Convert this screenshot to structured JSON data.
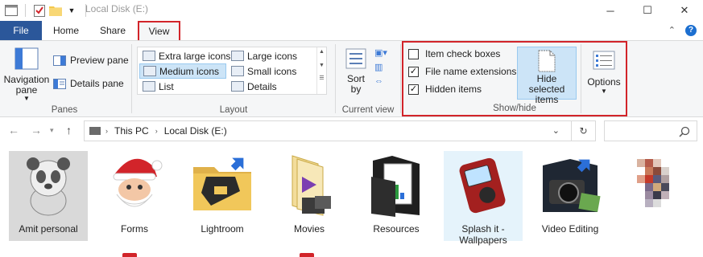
{
  "window": {
    "title": "Local Disk (E:)",
    "controls": {
      "minimize": "─",
      "maximize": "☐",
      "close": "✕"
    }
  },
  "quick_access": {
    "icons": [
      "explorer-icon",
      "properties-check-icon",
      "new-folder-icon",
      "customize-dropdown-icon"
    ]
  },
  "tabs": [
    {
      "label": "File"
    },
    {
      "label": "Home"
    },
    {
      "label": "Share"
    },
    {
      "label": "View"
    }
  ],
  "ribbon": {
    "panes": {
      "navigation_pane": "Navigation pane",
      "preview_pane": "Preview pane",
      "details_pane": "Details pane",
      "label": "Panes"
    },
    "layout": {
      "items": [
        "Extra large icons",
        "Large icons",
        "Medium icons",
        "Small icons",
        "List",
        "Details"
      ],
      "selected": "Medium icons",
      "label": "Layout"
    },
    "current_view": {
      "sort_by": "Sort by",
      "label": "Current view"
    },
    "show_hide": {
      "item_check_boxes": "Item check boxes",
      "file_name_extensions": "File name extensions",
      "hidden_items": "Hidden items",
      "item_check_boxes_checked": false,
      "file_name_extensions_checked": true,
      "hidden_items_checked": true,
      "hide_selected_items": "Hide selected items",
      "label": "Show/hide"
    },
    "options": {
      "label": "Options"
    }
  },
  "address": {
    "crumbs": [
      "This PC",
      "Local Disk (E:)"
    ]
  },
  "files": [
    {
      "name": "Amit personal",
      "icon": "panda-folder-icon",
      "state": "selected"
    },
    {
      "name": "Forms",
      "icon": "santa-folder-icon",
      "state": "normal"
    },
    {
      "name": "Lightroom",
      "icon": "lightroom-folder-icon",
      "state": "normal"
    },
    {
      "name": "Movies",
      "icon": "mp4-folder-icon",
      "state": "normal"
    },
    {
      "name": "Resources",
      "icon": "resources-folder-icon",
      "state": "normal"
    },
    {
      "name": "Splash it - Wallpapers",
      "icon": "music-player-folder-icon",
      "state": "hover"
    },
    {
      "name": "Video Editing",
      "icon": "camera-folder-icon",
      "state": "normal"
    },
    {
      "name": "",
      "icon": "pixelated-folder-icon",
      "state": "normal"
    }
  ],
  "colors": {
    "file_tab": "#2b579a",
    "highlight_box": "#d2242a",
    "selection": "#cce4f7"
  }
}
